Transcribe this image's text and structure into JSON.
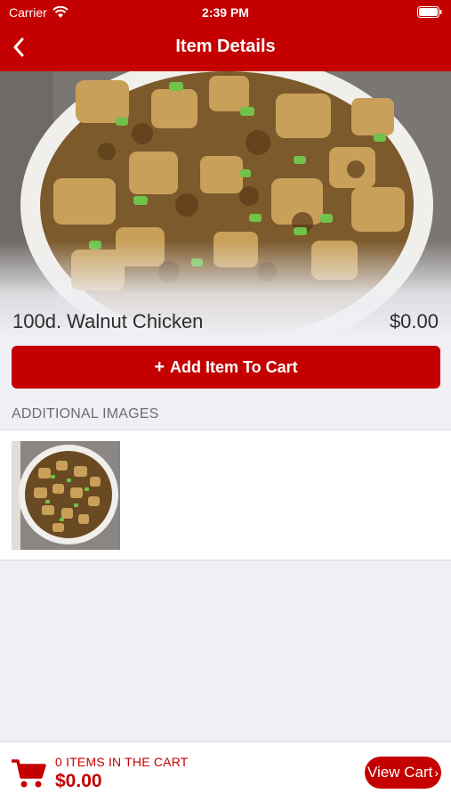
{
  "status_bar": {
    "carrier": "Carrier",
    "time": "2:39 PM"
  },
  "nav": {
    "title": "Item Details",
    "back_icon": "chevron-left-icon"
  },
  "item": {
    "name": "100d. Walnut Chicken",
    "price": "$0.00"
  },
  "actions": {
    "add_to_cart_label": "Add Item To Cart",
    "add_icon": "plus-icon"
  },
  "additional_images": {
    "header": "ADDITIONAL IMAGES"
  },
  "cart": {
    "count_label": "0 ITEMS IN THE CART",
    "total": "$0.00",
    "view_cart_label": "View Cart",
    "cart_icon": "shopping-cart-icon"
  },
  "colors": {
    "brand_red": "#c40000",
    "background": "#efeff4"
  }
}
